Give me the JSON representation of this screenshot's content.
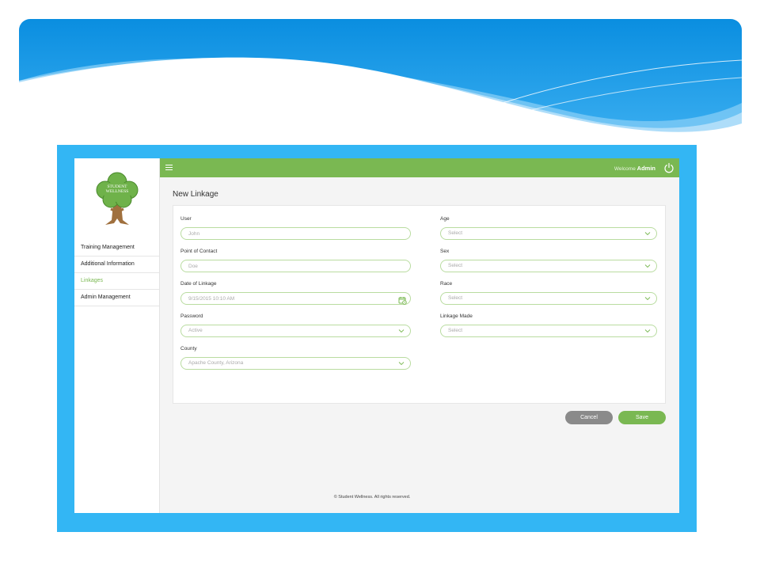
{
  "app": {
    "logo_text_line1": "STUDENT",
    "logo_text_line2": "WELLNESS"
  },
  "topbar": {
    "welcome_prefix": "Welcome",
    "user_name": "Admin"
  },
  "sidebar": {
    "items": [
      {
        "label": "Training Management",
        "active": false
      },
      {
        "label": "Additional Information",
        "active": false
      },
      {
        "label": "Linkages",
        "active": true
      },
      {
        "label": "Admin Management",
        "active": false
      }
    ]
  },
  "page": {
    "title": "New Linkage"
  },
  "form": {
    "user": {
      "label": "User",
      "value": "John"
    },
    "point_of_contact": {
      "label": "Point of Contact",
      "value": "Doe"
    },
    "date_of_linkage": {
      "label": "Date of Linkage",
      "value": "9/15/2015 10:10 AM"
    },
    "password": {
      "label": "Password",
      "value": "Active"
    },
    "county": {
      "label": "County",
      "value": "Apache County, Arizona"
    },
    "age": {
      "label": "Age",
      "value": "Select"
    },
    "sex": {
      "label": "Sex",
      "value": "Select"
    },
    "race": {
      "label": "Race",
      "value": "Select"
    },
    "linkage_made": {
      "label": "Linkage Made",
      "value": "Select"
    }
  },
  "actions": {
    "cancel_label": "Cancel",
    "save_label": "Save"
  },
  "footer": {
    "copyright": "© Student Wellness. All rights reserved."
  },
  "colors": {
    "accent_green": "#7ab852",
    "frame_blue": "#33b6f4",
    "cancel_gray": "#8a8a8a"
  }
}
